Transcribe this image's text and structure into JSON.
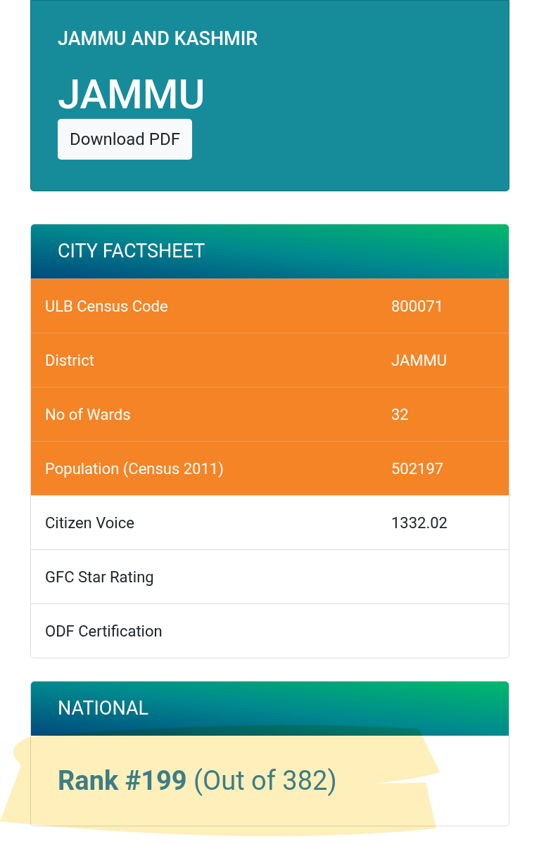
{
  "city_header": {
    "state": "JAMMU AND KASHMIR",
    "city": "JAMMU",
    "download_button": "Download PDF"
  },
  "factsheet": {
    "title": "CITY FACTSHEET",
    "rows": [
      {
        "label": "ULB Census Code",
        "value": "800071",
        "highlighted": true
      },
      {
        "label": "District",
        "value": "JAMMU",
        "highlighted": true
      },
      {
        "label": "No of Wards",
        "value": "32",
        "highlighted": true
      },
      {
        "label": "Population (Census 2011)",
        "value": "502197",
        "highlighted": true
      },
      {
        "label": "Citizen Voice",
        "value": "1332.02",
        "highlighted": false
      },
      {
        "label": "GFC Star Rating",
        "highlighted": false
      },
      {
        "label": "ODF Certification",
        "highlighted": false
      }
    ]
  },
  "national": {
    "title": "NATIONAL",
    "rank": "**Rank #199** (Out of 382)",
    "marked": true
  }
}
